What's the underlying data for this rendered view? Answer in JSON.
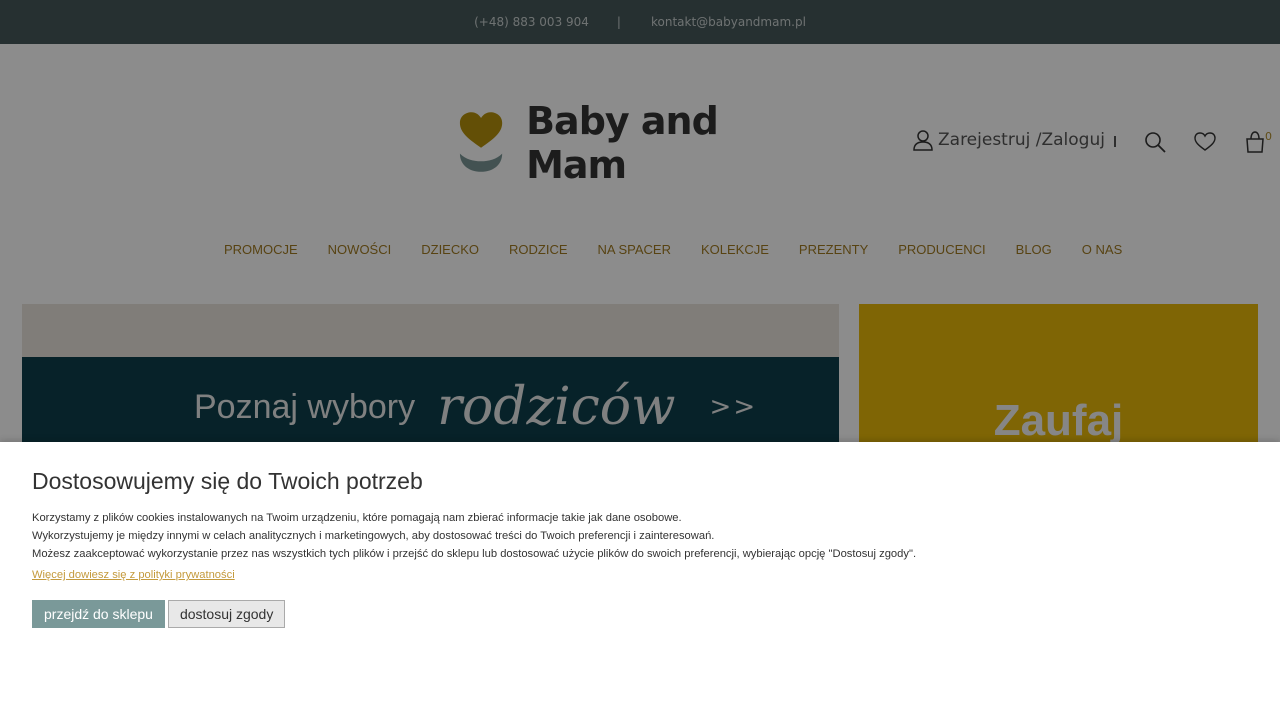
{
  "topbar": {
    "phone": "(+48) 883 003 904",
    "separator": "|",
    "email": "kontakt@babyandmam.pl"
  },
  "header": {
    "logo_text": "Baby and Mam",
    "account_label": "Zarejestruj /Zaloguj",
    "cart_count": "0",
    "icons": [
      "user-icon",
      "search-icon",
      "heart-icon",
      "cart-icon"
    ]
  },
  "nav": {
    "items": [
      "PROMOCJE",
      "NOWOŚCI",
      "DZIECKO",
      "RODZICE",
      "NA SPACER",
      "KOLEKCJE",
      "PREZENTY",
      "PRODUCENCI",
      "BLOG",
      "O NAS"
    ]
  },
  "hero": {
    "text": "Poznaj wybory",
    "script_text": "rodziców",
    "arrows": ">>"
  },
  "side_banner": {
    "text": "Zaufaj"
  },
  "cookie": {
    "title": "Dostosowujemy się do Twoich potrzeb",
    "line1": "Korzystamy z plików cookies instalowanych na Twoim urządzeniu, które pomagają nam zbierać informacje takie jak dane osobowe.",
    "line2": "Wykorzystujemy je między innymi w celach analitycznych i marketingowych, aby dostosować treści do Twoich preferencji i zainteresowań.",
    "line3": "Możesz zaakceptować wykorzystanie przez nas wszystkich tych plików i przejść do sklepu lub dostosować użycie plików do swoich preferencji, wybierając opcję \"Dostosuj zgody\".",
    "policy_link": "Więcej dowiesz się z polityki prywatności",
    "accept_label": "przejdź do sklepu",
    "customize_label": "dostosuj zgody"
  },
  "colors": {
    "topbar": "#46585a",
    "nav_text": "#a07a22",
    "hero_band": "#0d3e4b",
    "side_banner": "#e8b90a",
    "accept_button": "#7a9999",
    "link": "#c49a3c"
  }
}
